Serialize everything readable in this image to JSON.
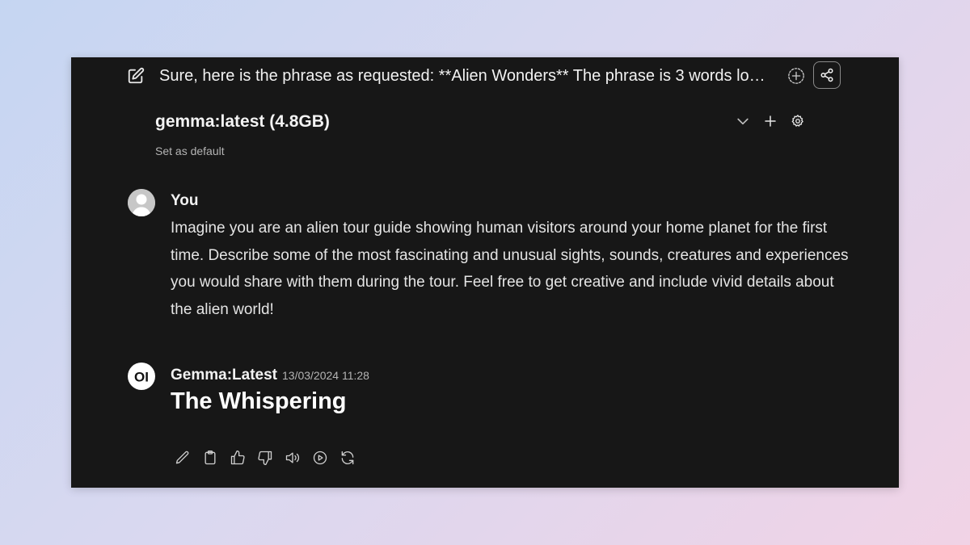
{
  "header": {
    "chat_title": "Sure, here is the phrase as requested: **Alien Wonders** The phrase is 3 words long..."
  },
  "model": {
    "name": "gemma:latest (4.8GB)",
    "set_default_label": "Set as default"
  },
  "user_message": {
    "author": "You",
    "text": "Imagine you are an alien tour guide showing human visitors around your home planet for the first time. Describe some of the most fascinating and unusual sights, sounds, creatures and experiences you would share with them during the tour. Feel free to get creative and include vivid details about the alien world!"
  },
  "bot_message": {
    "author": "Gemma:Latest",
    "timestamp": "13/03/2024 11:28",
    "avatar_text": "OI",
    "text": "The Whispering"
  },
  "icons": {
    "header": [
      "edit-icon",
      "add-circle-icon",
      "share-icon"
    ],
    "model_controls": [
      "chevron-down-icon",
      "plus-icon",
      "gear-icon"
    ],
    "actions": [
      "pencil-icon",
      "clipboard-icon",
      "thumbs-up-icon",
      "thumbs-down-icon",
      "speaker-icon",
      "play-circle-icon",
      "refresh-icon"
    ]
  },
  "colors": {
    "window_bg": "#171717",
    "text_primary": "#f2f2f2",
    "text_muted": "#b4b4b4"
  }
}
